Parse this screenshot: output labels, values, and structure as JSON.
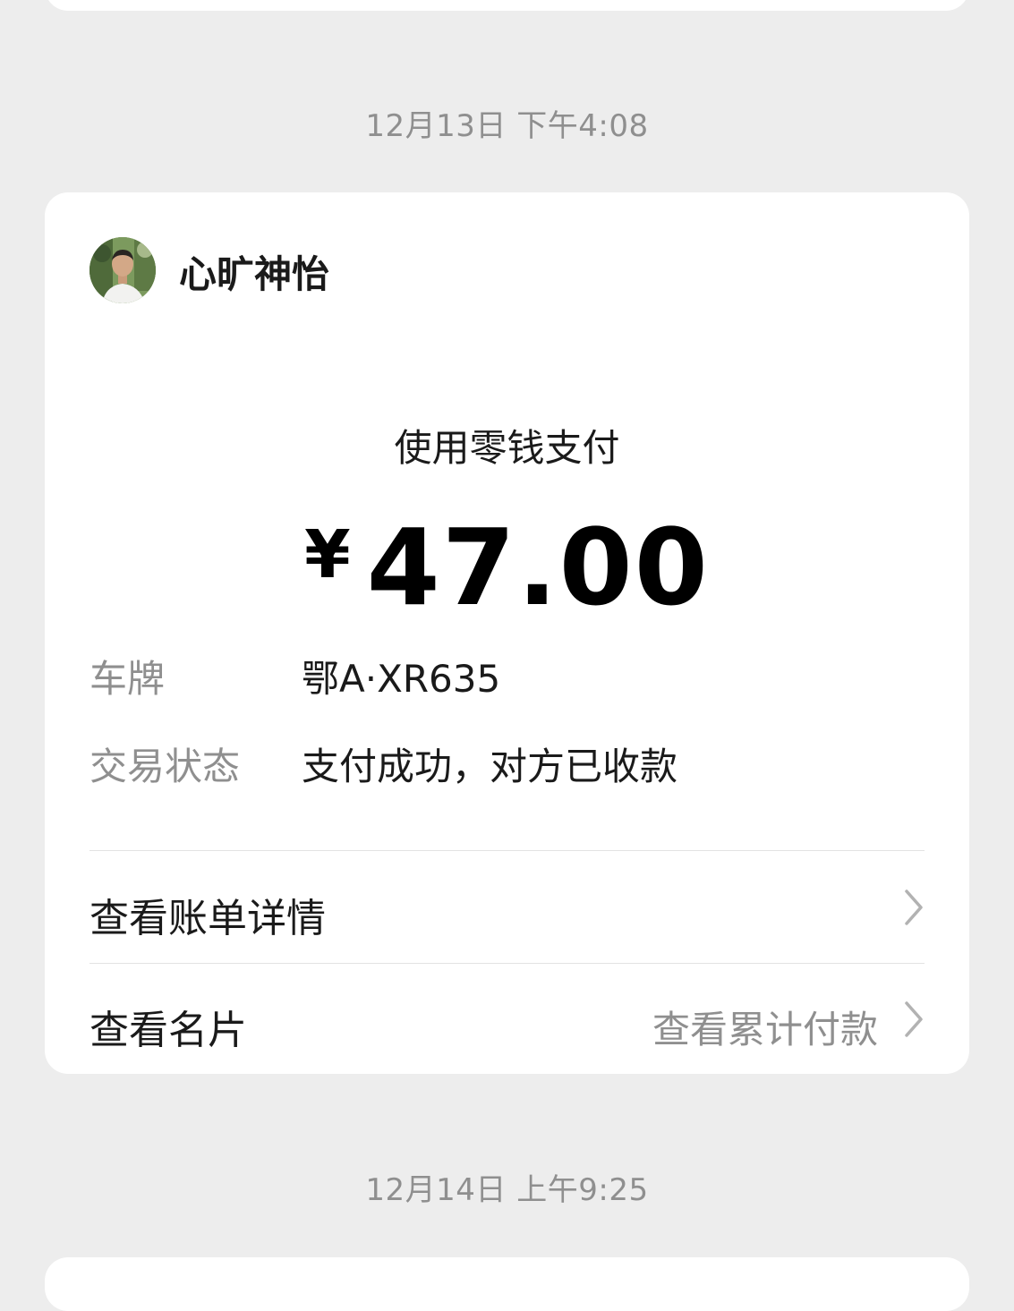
{
  "messages": [
    {
      "timestamp": "12月13日 下午4:08",
      "sender": {
        "name": "心旷神怡",
        "avatar_icon": "person-photo-icon"
      },
      "payment": {
        "method": "使用零钱支付",
        "currency_symbol": "¥",
        "amount": "47.00"
      },
      "details": [
        {
          "label": "车牌",
          "value": "鄂A·XR635"
        },
        {
          "label": "交易状态",
          "value": "支付成功，对方已收款"
        }
      ],
      "actions": [
        {
          "label": "查看账单详情",
          "sub_label": "",
          "icon": "chevron-right-icon"
        },
        {
          "label": "查看名片",
          "sub_label": "查看累计付款",
          "icon": "chevron-right-icon"
        }
      ]
    },
    {
      "timestamp": "12月14日 上午9:25"
    }
  ],
  "colors": {
    "background": "#ededed",
    "card": "#ffffff",
    "primary_text": "#1a1a1a",
    "secondary_text": "#8f8f8f",
    "divider": "#e3e3e3"
  }
}
